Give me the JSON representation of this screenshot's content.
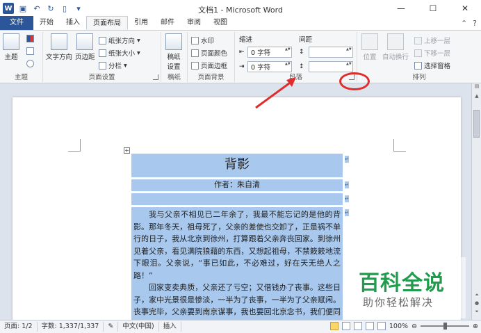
{
  "window": {
    "title": "文档1 - Microsoft Word",
    "logo": "W"
  },
  "tabs": [
    "文件",
    "开始",
    "插入",
    "页面布局",
    "引用",
    "邮件",
    "审阅",
    "视图"
  ],
  "ribbon": {
    "theme": {
      "label": "主题",
      "btn": "主题"
    },
    "page_setup": {
      "label": "页面设置",
      "text_direction": "文字方向",
      "margins": "页边距",
      "orientation": "纸张方向",
      "size": "纸张大小",
      "columns": "分栏"
    },
    "draft": {
      "label": "稿纸",
      "btn1": "稿纸",
      "btn2": "设置"
    },
    "page_bg": {
      "label": "页面背景",
      "watermark": "水印",
      "page_color": "页面颜色",
      "page_border": "页面边框"
    },
    "paragraph": {
      "label": "段落",
      "indent": "缩进",
      "spacing": "间距",
      "indent_left": "0 字符",
      "indent_right": "0 字符"
    },
    "arrange": {
      "label": "排列",
      "position": "位置",
      "wrap": "自动换行",
      "bring_forward": "上移一层",
      "send_backward": "下移一层",
      "selection_pane": "选择窗格"
    }
  },
  "document": {
    "title": "背影",
    "author": "作者：朱自清",
    "body": [
      "我与父亲不相见已二年余了，我最不能忘记的是他的背影。那年冬天，祖母死了，父亲的差使也交卸了，正是祸不单行的日子，我从北京到徐州，打算跟着父亲奔丧回家。到徐州见着父亲，看见满院狼藉的东西，又想起祖母，不禁簌簌地流下眼泪。父亲说，“事已如此，不必难过，好在天无绝人之路！”",
      "回家变卖典质，父亲还了亏空；又借钱办了丧事。这些日子，家中光景很是惨淡，一半为了丧事，一半为了父亲赋闲。丧事完毕，父亲要到南京谋事，我也要回北京念书，我们便同行。"
    ]
  },
  "status": {
    "page": "页面: 1/2",
    "words": "字数: 1,337/1,337",
    "lang": "中文(中国)",
    "mode": "插入",
    "zoom": "100%"
  },
  "watermark": {
    "brand": "百科全说",
    "slogan": "助你轻松解决"
  },
  "colors": {
    "accent": "#2b579a",
    "selection": "#a8c8ee",
    "annotation": "#e02c2c",
    "brand_green": "#1f9d4c"
  }
}
